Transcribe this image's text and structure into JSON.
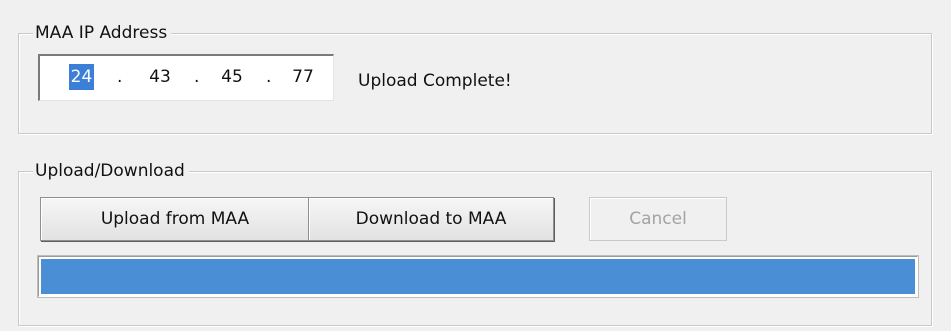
{
  "ip_group": {
    "title": "MAA IP Address",
    "octets": [
      "24",
      "43",
      "45",
      "77"
    ],
    "separator": ".",
    "status": "Upload Complete!"
  },
  "transfer_group": {
    "title": "Upload/Download",
    "upload_label": "Upload from MAA",
    "download_label": "Download to MAA",
    "cancel_label": "Cancel",
    "cancel_enabled": false,
    "progress_fraction": 1.0
  },
  "colors": {
    "progress_fill": "#4a8fd6",
    "selection": "#3b7fd9"
  }
}
